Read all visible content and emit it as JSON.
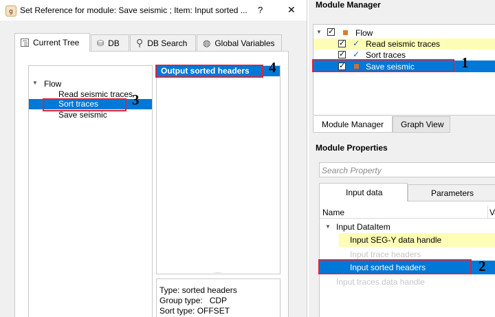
{
  "dialog": {
    "title": "Set Reference for module: Save seismic ; Item: Input sorted ...",
    "help": "?",
    "close": "✕",
    "tabs": [
      "Current Tree",
      "DB",
      "DB Search",
      "Global Variables"
    ],
    "tree": {
      "root": "Flow",
      "items": [
        "Read seismic traces",
        "Sort traces",
        "Save seismic"
      ],
      "selected": "Sort traces"
    },
    "items_list": [
      "Output sorted headers"
    ],
    "info": [
      "Type: sorted headers",
      "Group type:   CDP",
      "Sort type: OFFSET"
    ],
    "resize_grip": "....."
  },
  "module_manager": {
    "title": "Module Manager",
    "tree": {
      "root": "Flow",
      "items": [
        "Read seismic traces",
        "Sort traces",
        "Save seismic"
      ],
      "selected": "Save seismic"
    },
    "tabs": [
      "Module Manager",
      "Graph View"
    ]
  },
  "module_properties": {
    "title": "Module Properties",
    "search_placeholder": "Search Property",
    "tabs": [
      "Input data",
      "Parameters"
    ],
    "columns": [
      "Name",
      "Va"
    ],
    "group": "Input DataItem",
    "rows": [
      "Input SEG-Y data handle",
      "Input trace headers",
      "Input sorted headers",
      "Input traces data handle"
    ]
  },
  "annotations": [
    "1",
    "2",
    "3",
    "4"
  ],
  "colors": {
    "selection": "#0078d7",
    "highlight": "#fdfdb5",
    "annotation": "#d8263b",
    "flow_icon": "#e07a2c"
  }
}
